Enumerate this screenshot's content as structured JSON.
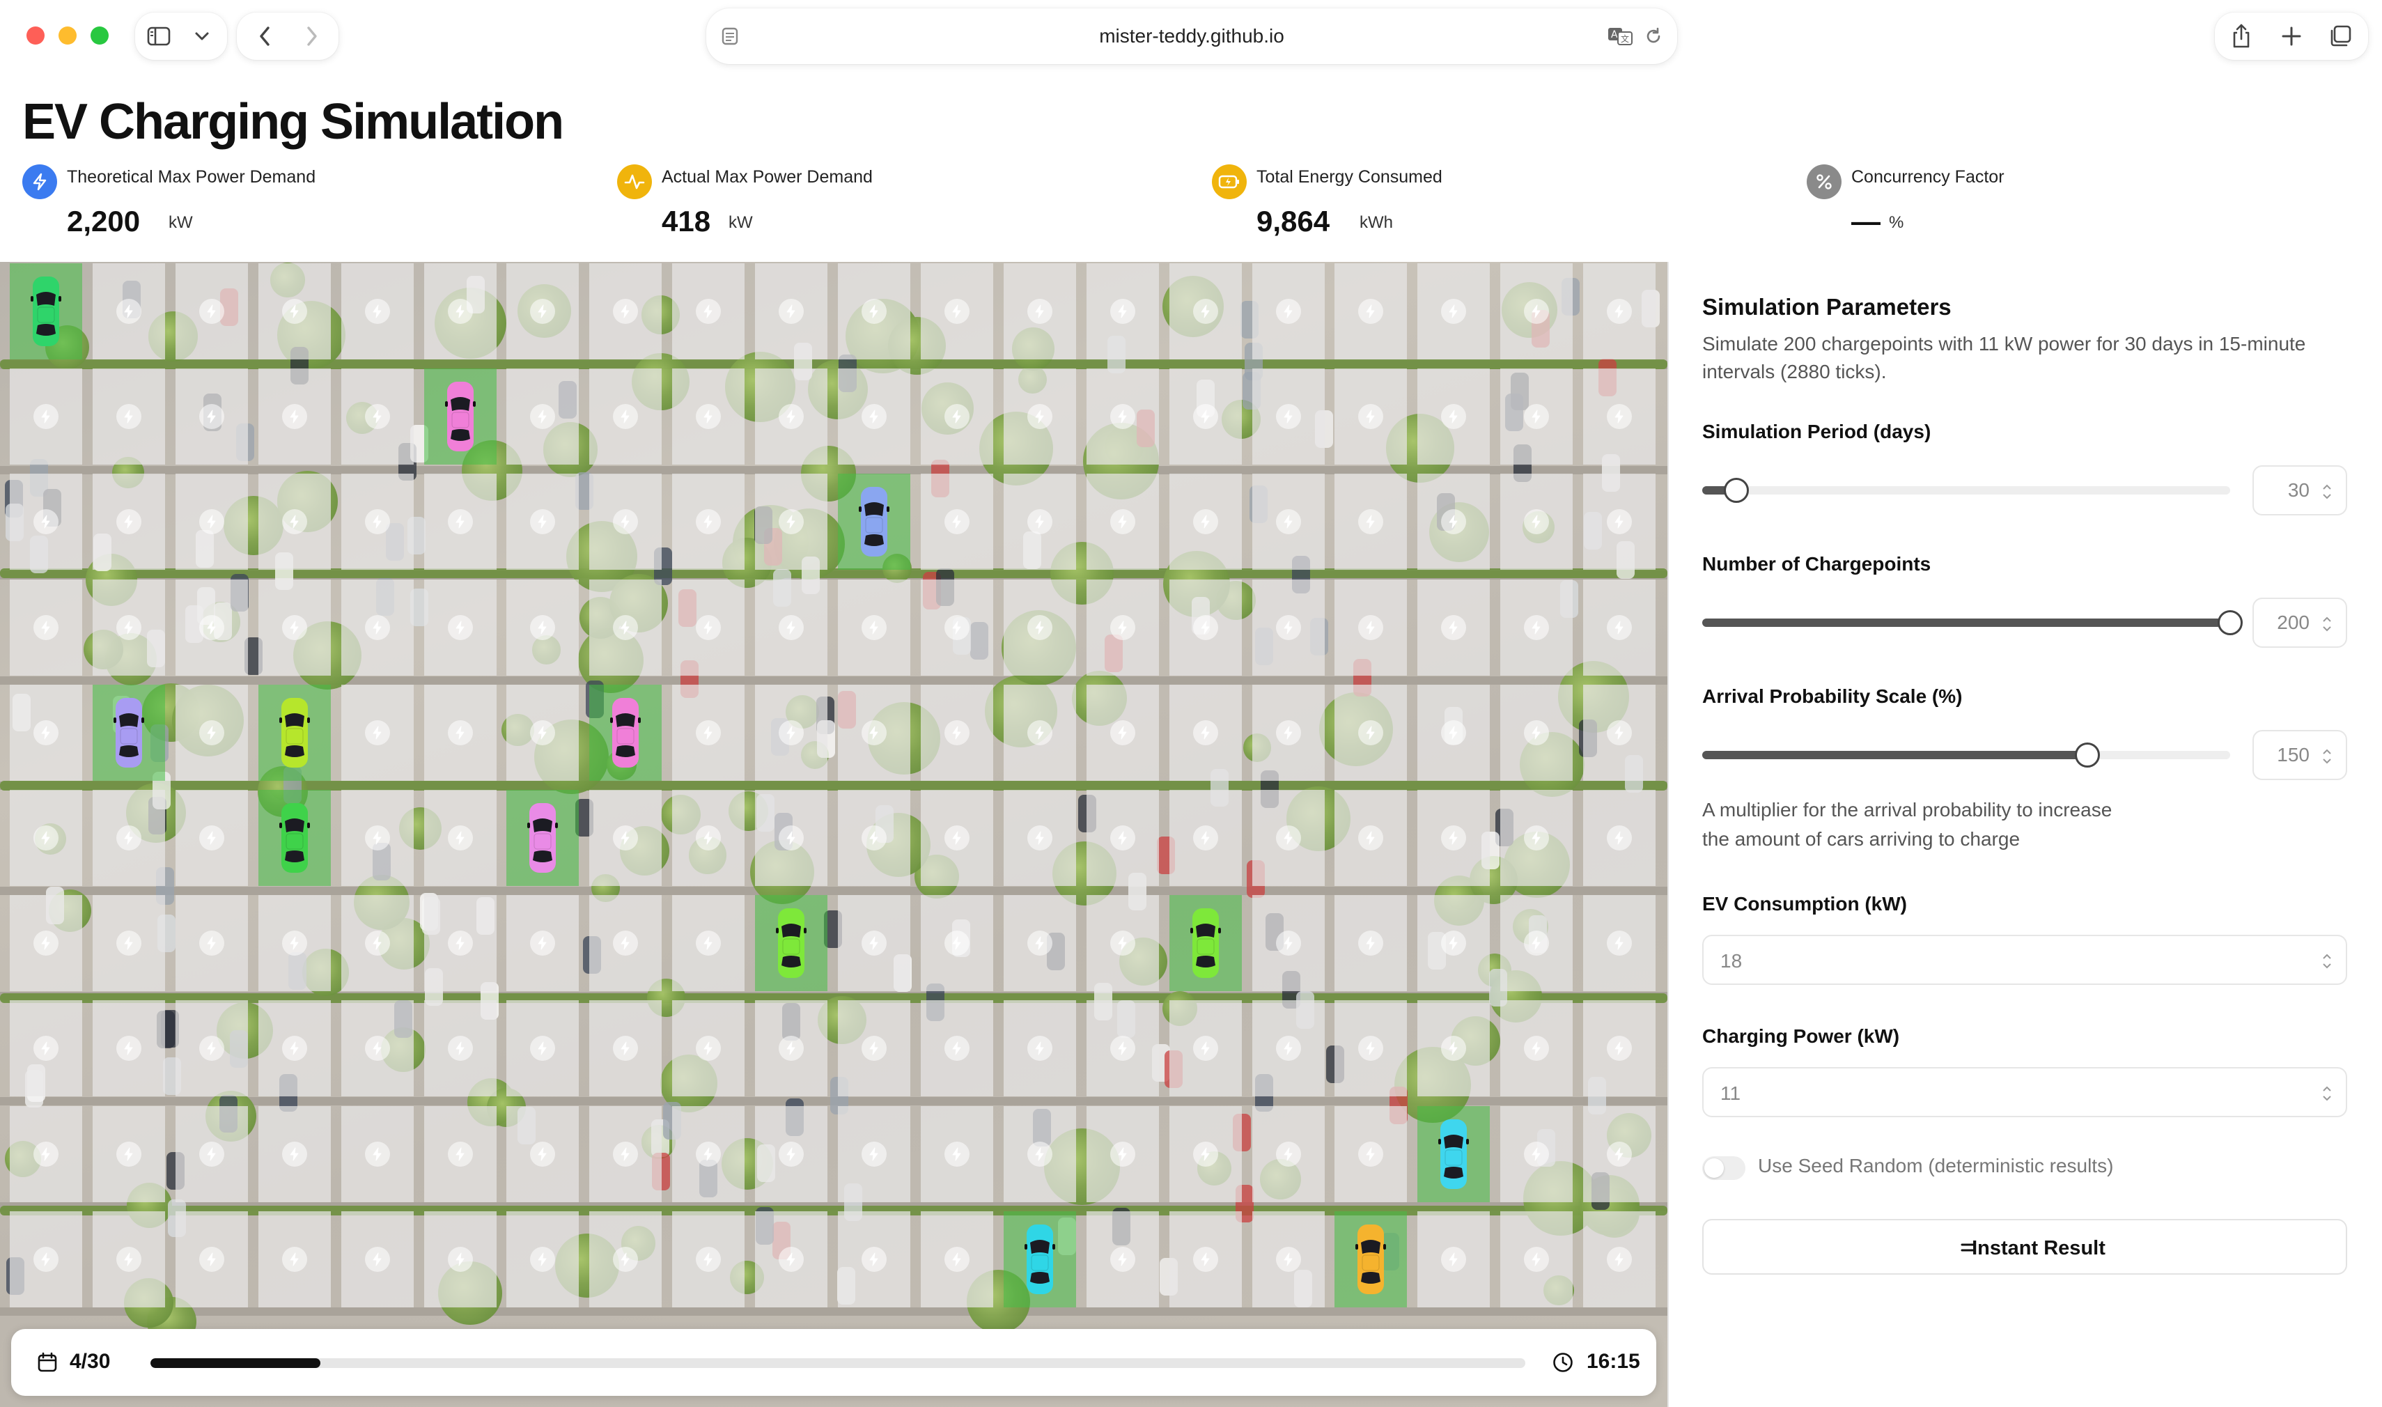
{
  "browser": {
    "url": "mister-teddy.github.io",
    "icons": [
      "sidebar-toggle-icon",
      "chevron-down-icon",
      "back-icon",
      "forward-icon",
      "reader-icon",
      "translate-icon",
      "reload-icon",
      "share-icon",
      "new-tab-icon",
      "tab-overview-icon"
    ]
  },
  "header": {
    "title": "EV Charging Simulation",
    "metrics": [
      {
        "label": "Theoretical Max Power Demand",
        "value": "2,200",
        "unit": "kW",
        "icon": "bolt-icon",
        "color": "#3b7bf0"
      },
      {
        "label": "Actual Max Power Demand",
        "value": "418",
        "unit": "kW",
        "icon": "activity-icon",
        "color": "#f0b40c"
      },
      {
        "label": "Total Energy Consumed",
        "value": "9,864",
        "unit": "kWh",
        "icon": "battery-charging-icon",
        "color": "#f0b40c"
      },
      {
        "label": "Concurrency Factor",
        "value": "—",
        "unit": "%",
        "icon": "percent-icon",
        "color": "#888888"
      }
    ]
  },
  "simulation": {
    "grid": {
      "columns": 20,
      "rows": 10
    },
    "charging_spots": [
      {
        "row": 0,
        "col": 0,
        "car_color": "#2fd46a"
      },
      {
        "row": 1,
        "col": 5,
        "car_color": "#f07fd8"
      },
      {
        "row": 2,
        "col": 10,
        "car_color": "#8aa6f0"
      },
      {
        "row": 4,
        "col": 1,
        "car_color": "#a89cf2"
      },
      {
        "row": 4,
        "col": 3,
        "car_color": "#b6e62c"
      },
      {
        "row": 4,
        "col": 7,
        "car_color": "#f07fd8"
      },
      {
        "row": 5,
        "col": 3,
        "car_color": "#3fd24a"
      },
      {
        "row": 5,
        "col": 6,
        "car_color": "#e98be6"
      },
      {
        "row": 6,
        "col": 9,
        "car_color": "#7ee83a"
      },
      {
        "row": 6,
        "col": 14,
        "car_color": "#7ee83a"
      },
      {
        "row": 8,
        "col": 17,
        "car_color": "#3fd6ee"
      },
      {
        "row": 9,
        "col": 12,
        "car_color": "#2fd6e6"
      },
      {
        "row": 9,
        "col": 16,
        "car_color": "#f5b32e"
      }
    ],
    "progress": {
      "day": "4/30",
      "fraction": 0.1236,
      "time": "16:15"
    }
  },
  "params": {
    "title": "Simulation Parameters",
    "description": "Simulate 200 chargepoints with 11 kW power for 30 days in 15-minute intervals (2880 ticks).",
    "sliders": [
      {
        "label": "Simulation Period (days)",
        "value": "30",
        "fraction": 0.065
      },
      {
        "label": "Number of Chargepoints",
        "value": "200",
        "fraction": 1.0
      },
      {
        "label": "Arrival Probability Scale (%)",
        "value": "150",
        "fraction": 0.73
      }
    ],
    "arrival_help": "A multiplier for the arrival probability to increase the amount of cars arriving to charge",
    "ev_consumption": {
      "label": "EV Consumption (kW)",
      "value": "18"
    },
    "charging_power": {
      "label": "Charging Power (kW)",
      "value": "11"
    },
    "seed_toggle": {
      "label": "Use Seed Random (deterministic results)",
      "on": false
    },
    "instant_button": "Instant Result"
  }
}
